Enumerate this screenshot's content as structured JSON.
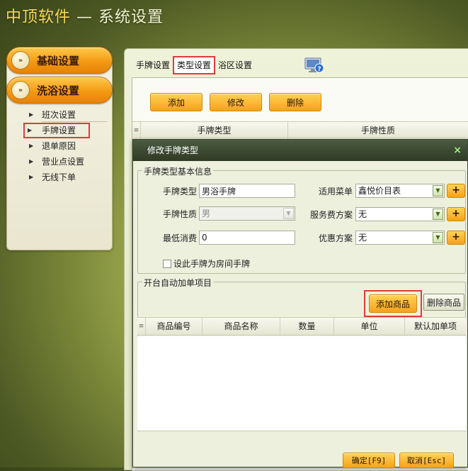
{
  "app": {
    "brand": "中顶软件",
    "separator": " — ",
    "title": "系统设置"
  },
  "sidebar": {
    "categories": [
      {
        "label": "基础设置"
      },
      {
        "label": "洗浴设置"
      }
    ],
    "items": [
      {
        "label": "班次设置"
      },
      {
        "label": "手牌设置"
      },
      {
        "label": "退单原因"
      },
      {
        "label": "营业点设置"
      },
      {
        "label": "无线下单"
      }
    ],
    "active_item": "手牌设置"
  },
  "tabs": [
    {
      "label": "手牌设置"
    },
    {
      "label": "类型设置"
    },
    {
      "label": "浴区设置"
    }
  ],
  "active_tab": "类型设置",
  "toolbar": {
    "add": "添加",
    "edit": "修改",
    "delete": "删除"
  },
  "list_columns": [
    "手牌类型",
    "手牌性质"
  ],
  "modal": {
    "title": "修改手牌类型",
    "close": "×",
    "basic_section": "手牌类型基本信息",
    "fields": {
      "card_type_label": "手牌类型",
      "card_type_value": "男浴手牌",
      "menu_label": "适用菜单",
      "menu_value": "鑫悦价目表",
      "nature_label": "手牌性质",
      "nature_value": "男",
      "service_fee_label": "服务费方案",
      "service_fee_value": "无",
      "min_spend_label": "最低消费",
      "min_spend_value": "0",
      "discount_label": "优惠方案",
      "discount_value": "无",
      "room_card_label": "设此手牌为房间手牌",
      "room_card_checked": false
    },
    "auto_section": "开台自动加单项目",
    "add_product": "添加商品",
    "delete_product": "删除商品",
    "grid_columns": [
      "商品编号",
      "商品名称",
      "数量",
      "单位",
      "默认加单项"
    ],
    "confirm": "确定[F9]",
    "cancel": "取消[Esc]"
  },
  "colors": {
    "accent_orange": "#f6a21c",
    "highlight_red": "#e03b3b",
    "modal_title_bg": "#3a4630"
  }
}
